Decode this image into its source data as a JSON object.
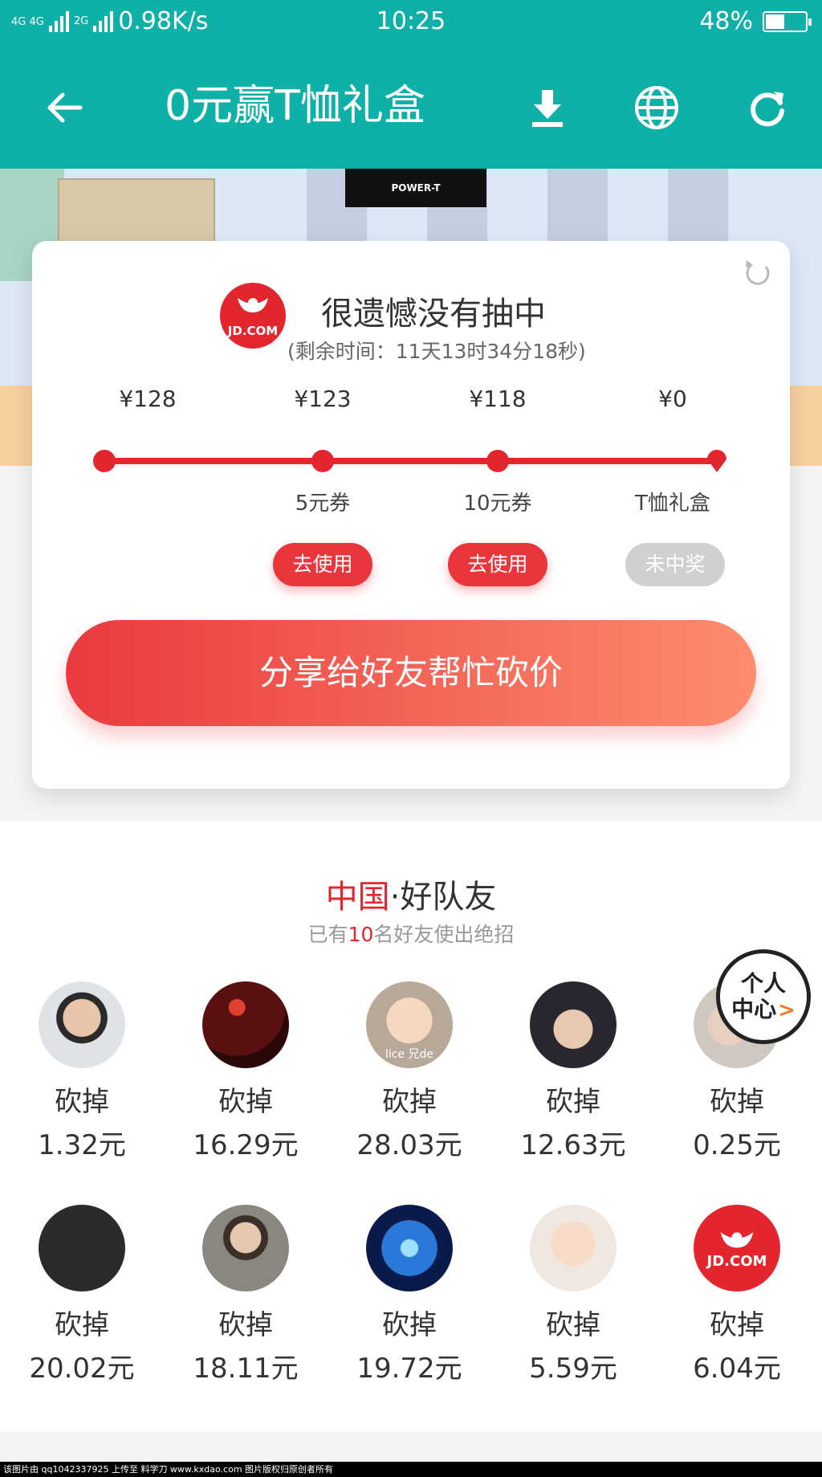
{
  "status": {
    "network": "4G 4G",
    "network2": "2G",
    "speed": "0.98K/s",
    "time": "10:25",
    "battery": "48%",
    "battery_level": 0.48
  },
  "nav": {
    "title": "0元赢T恤礼盒",
    "back_icon": "arrow-left-icon",
    "download_icon": "download-icon",
    "globe_icon": "globe-icon",
    "refresh_icon": "refresh-icon"
  },
  "hero": {
    "poster_text": "POWER-T"
  },
  "result": {
    "logo_text": "JD.COM",
    "title": "很遗憾没有抽中",
    "countdown": "(剩余时间：11天13时34分18秒)",
    "prices": [
      "¥128",
      "¥123",
      "¥118",
      "¥0"
    ],
    "prizes": [
      "5元券",
      "10元券",
      "T恤礼盒"
    ],
    "buttons": [
      "去使用",
      "去使用",
      "未中奖"
    ],
    "share_label": "分享给好友帮忙砍价"
  },
  "team": {
    "title_red": "中国",
    "title_rest": "·好队友",
    "sub_prefix": "已有",
    "sub_count": "10",
    "sub_suffix": "名好友使出绝招",
    "friends": [
      {
        "label": "砍掉",
        "amount": "1.32元"
      },
      {
        "label": "砍掉",
        "amount": "16.29元"
      },
      {
        "label": "砍掉",
        "amount": "28.03元",
        "avatar_text": "lice 兄de"
      },
      {
        "label": "砍掉",
        "amount": "12.63元"
      },
      {
        "label": "砍掉",
        "amount": "0.25元"
      },
      {
        "label": "砍掉",
        "amount": "20.02元"
      },
      {
        "label": "砍掉",
        "amount": "18.11元"
      },
      {
        "label": "砍掉",
        "amount": "19.72元"
      },
      {
        "label": "砍掉",
        "amount": "5.59元"
      },
      {
        "label": "砍掉",
        "amount": "6.04元",
        "avatar_text": "JD.COM"
      }
    ]
  },
  "personal_center": {
    "line1": "个人",
    "line2": "中心",
    "arrow": ">"
  },
  "footer": {
    "text": "该图片由 qq1042337925 上传至 料学刀 www.kxdao.com 图片版权归原创者所有"
  },
  "colors": {
    "teal": "#0fb0a8",
    "red": "#e3262e",
    "gradient_end": "#fc8d6e"
  }
}
